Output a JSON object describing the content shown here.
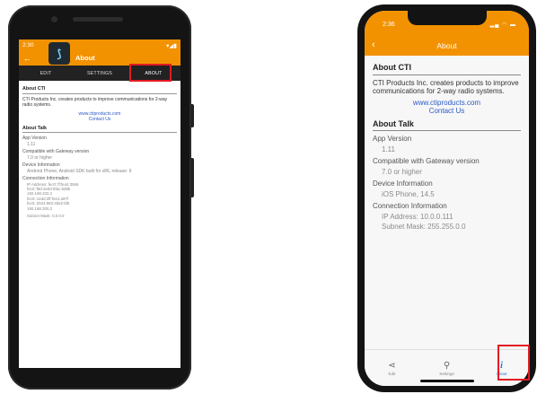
{
  "android": {
    "status_time": "2:30",
    "status_icons": "▾◢▮",
    "title": "About",
    "tabs": [
      "EDIT",
      "SETTINGS",
      "ABOUT"
    ],
    "about_cti_heading": "About CTI",
    "about_cti_text": "CTI Products Inc. creates products to improve communications for 2-way radio systems.",
    "website": "www.ctiproducts.com",
    "contact": "Contact Us",
    "about_talk_heading": "About Talk",
    "app_version_label": "App Version",
    "app_version": "1.11",
    "gateway_label": "Compatible with Gateway version",
    "gateway_value": "7.0 or higher",
    "device_label": "Device Information",
    "device_value": "Android Phone, Android SDK built for x86, release: 9",
    "connection_label": "Connection Information",
    "connection_lines": [
      "IP Address: fec0::ff:fe44:3566",
      "fec0::f8d:3e83:9fac:bd8b",
      "192.168.232.2",
      "fec0::14dd:2ff:fe61:a97f",
      "fec0::2024:982:4b62:5f5",
      "192.168.200.2"
    ],
    "subnet": "Subnet Mask: 0.0.0.0"
  },
  "ios": {
    "status_time": "2:36",
    "status_icons": "▂▄ ◠ ▬",
    "title": "About",
    "about_cti_heading": "About CTI",
    "about_cti_text": "CTI Products Inc. creates products to improve communications for 2-way radio systems.",
    "website": "www.ctiproducts.com",
    "contact": "Contact Us",
    "about_talk_heading": "About Talk",
    "app_version_label": "App Version",
    "app_version": "1.11",
    "gateway_label": "Compatible with Gateway version",
    "gateway_value": "7.0 or higher",
    "device_label": "Device Information",
    "device_value": "iOS Phone, 14.5",
    "connection_label": "Connection Information",
    "ip": "IP Address: 10.0.0.111",
    "subnet": "Subnet Mask: 255.255.0.0",
    "tabs": [
      "Edit",
      "Settings",
      "About"
    ]
  },
  "colors": {
    "accent": "#f39200",
    "highlight": "#e31b23",
    "link": "#2a59c4",
    "ios_tab_active": "#1d6fd8"
  }
}
